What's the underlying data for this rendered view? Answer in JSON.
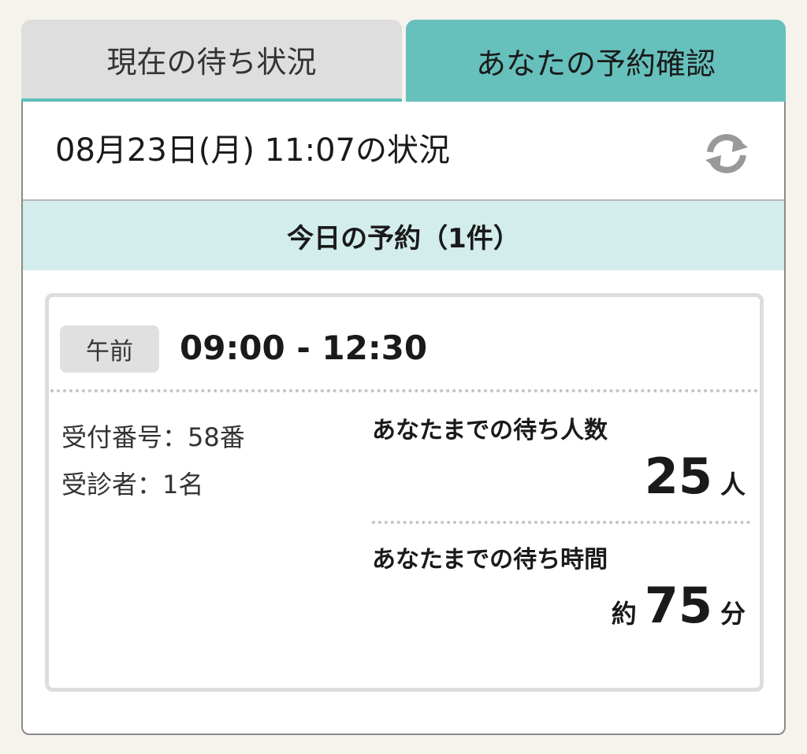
{
  "tabs": {
    "current_status": "現在の待ち状況",
    "your_reservation": "あなたの予約確認"
  },
  "status": {
    "text": "08月23日(月) 11:07の状況",
    "refresh_icon": "refresh-icon"
  },
  "today": {
    "title": "今日の予約（1件）"
  },
  "reservation": {
    "period": "午前",
    "time_range": "09:00 - 12:30",
    "reception_number": "受付番号：58番",
    "patients": "受診者：1名",
    "people_label": "あなたまでの待ち人数",
    "people_value": "25",
    "people_unit": "人",
    "time_label": "あなたまでの待ち時間",
    "time_prefix": "約",
    "time_value": "75",
    "time_unit": "分"
  },
  "colors": {
    "accent": "#66c0bc",
    "accent_light": "#d3ecec",
    "tab_inactive": "#dedede"
  }
}
